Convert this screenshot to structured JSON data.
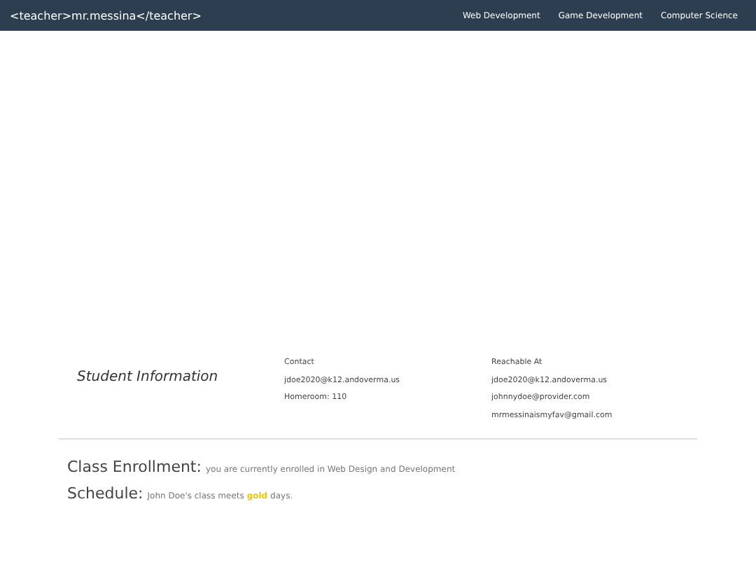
{
  "navbar": {
    "brand": "<teacher>mr.messina</teacher>",
    "links": [
      "Web Development",
      "Game Development",
      "Computer Science"
    ]
  },
  "student_info": {
    "title": "Student Information",
    "contact": {
      "heading": "Contact",
      "lines": [
        "jdoe2020@k12.andoverma.us",
        "Homeroom: 110"
      ]
    },
    "reachable": {
      "heading": "Reachable At",
      "lines": [
        "jdoe2020@k12.andoverma.us",
        "johnnydoe@provider.com",
        "mrmessinaismyfav@gmail.com"
      ]
    }
  },
  "enrollment": {
    "label": "Class Enrollment:",
    "text": "you are currently enrolled in Web Design and Development"
  },
  "schedule": {
    "label": "Schedule:",
    "text_before": "John Doe's class meets",
    "highlight": {
      "text": "gold",
      "color": "#f1c40f"
    },
    "text_after": "days."
  }
}
